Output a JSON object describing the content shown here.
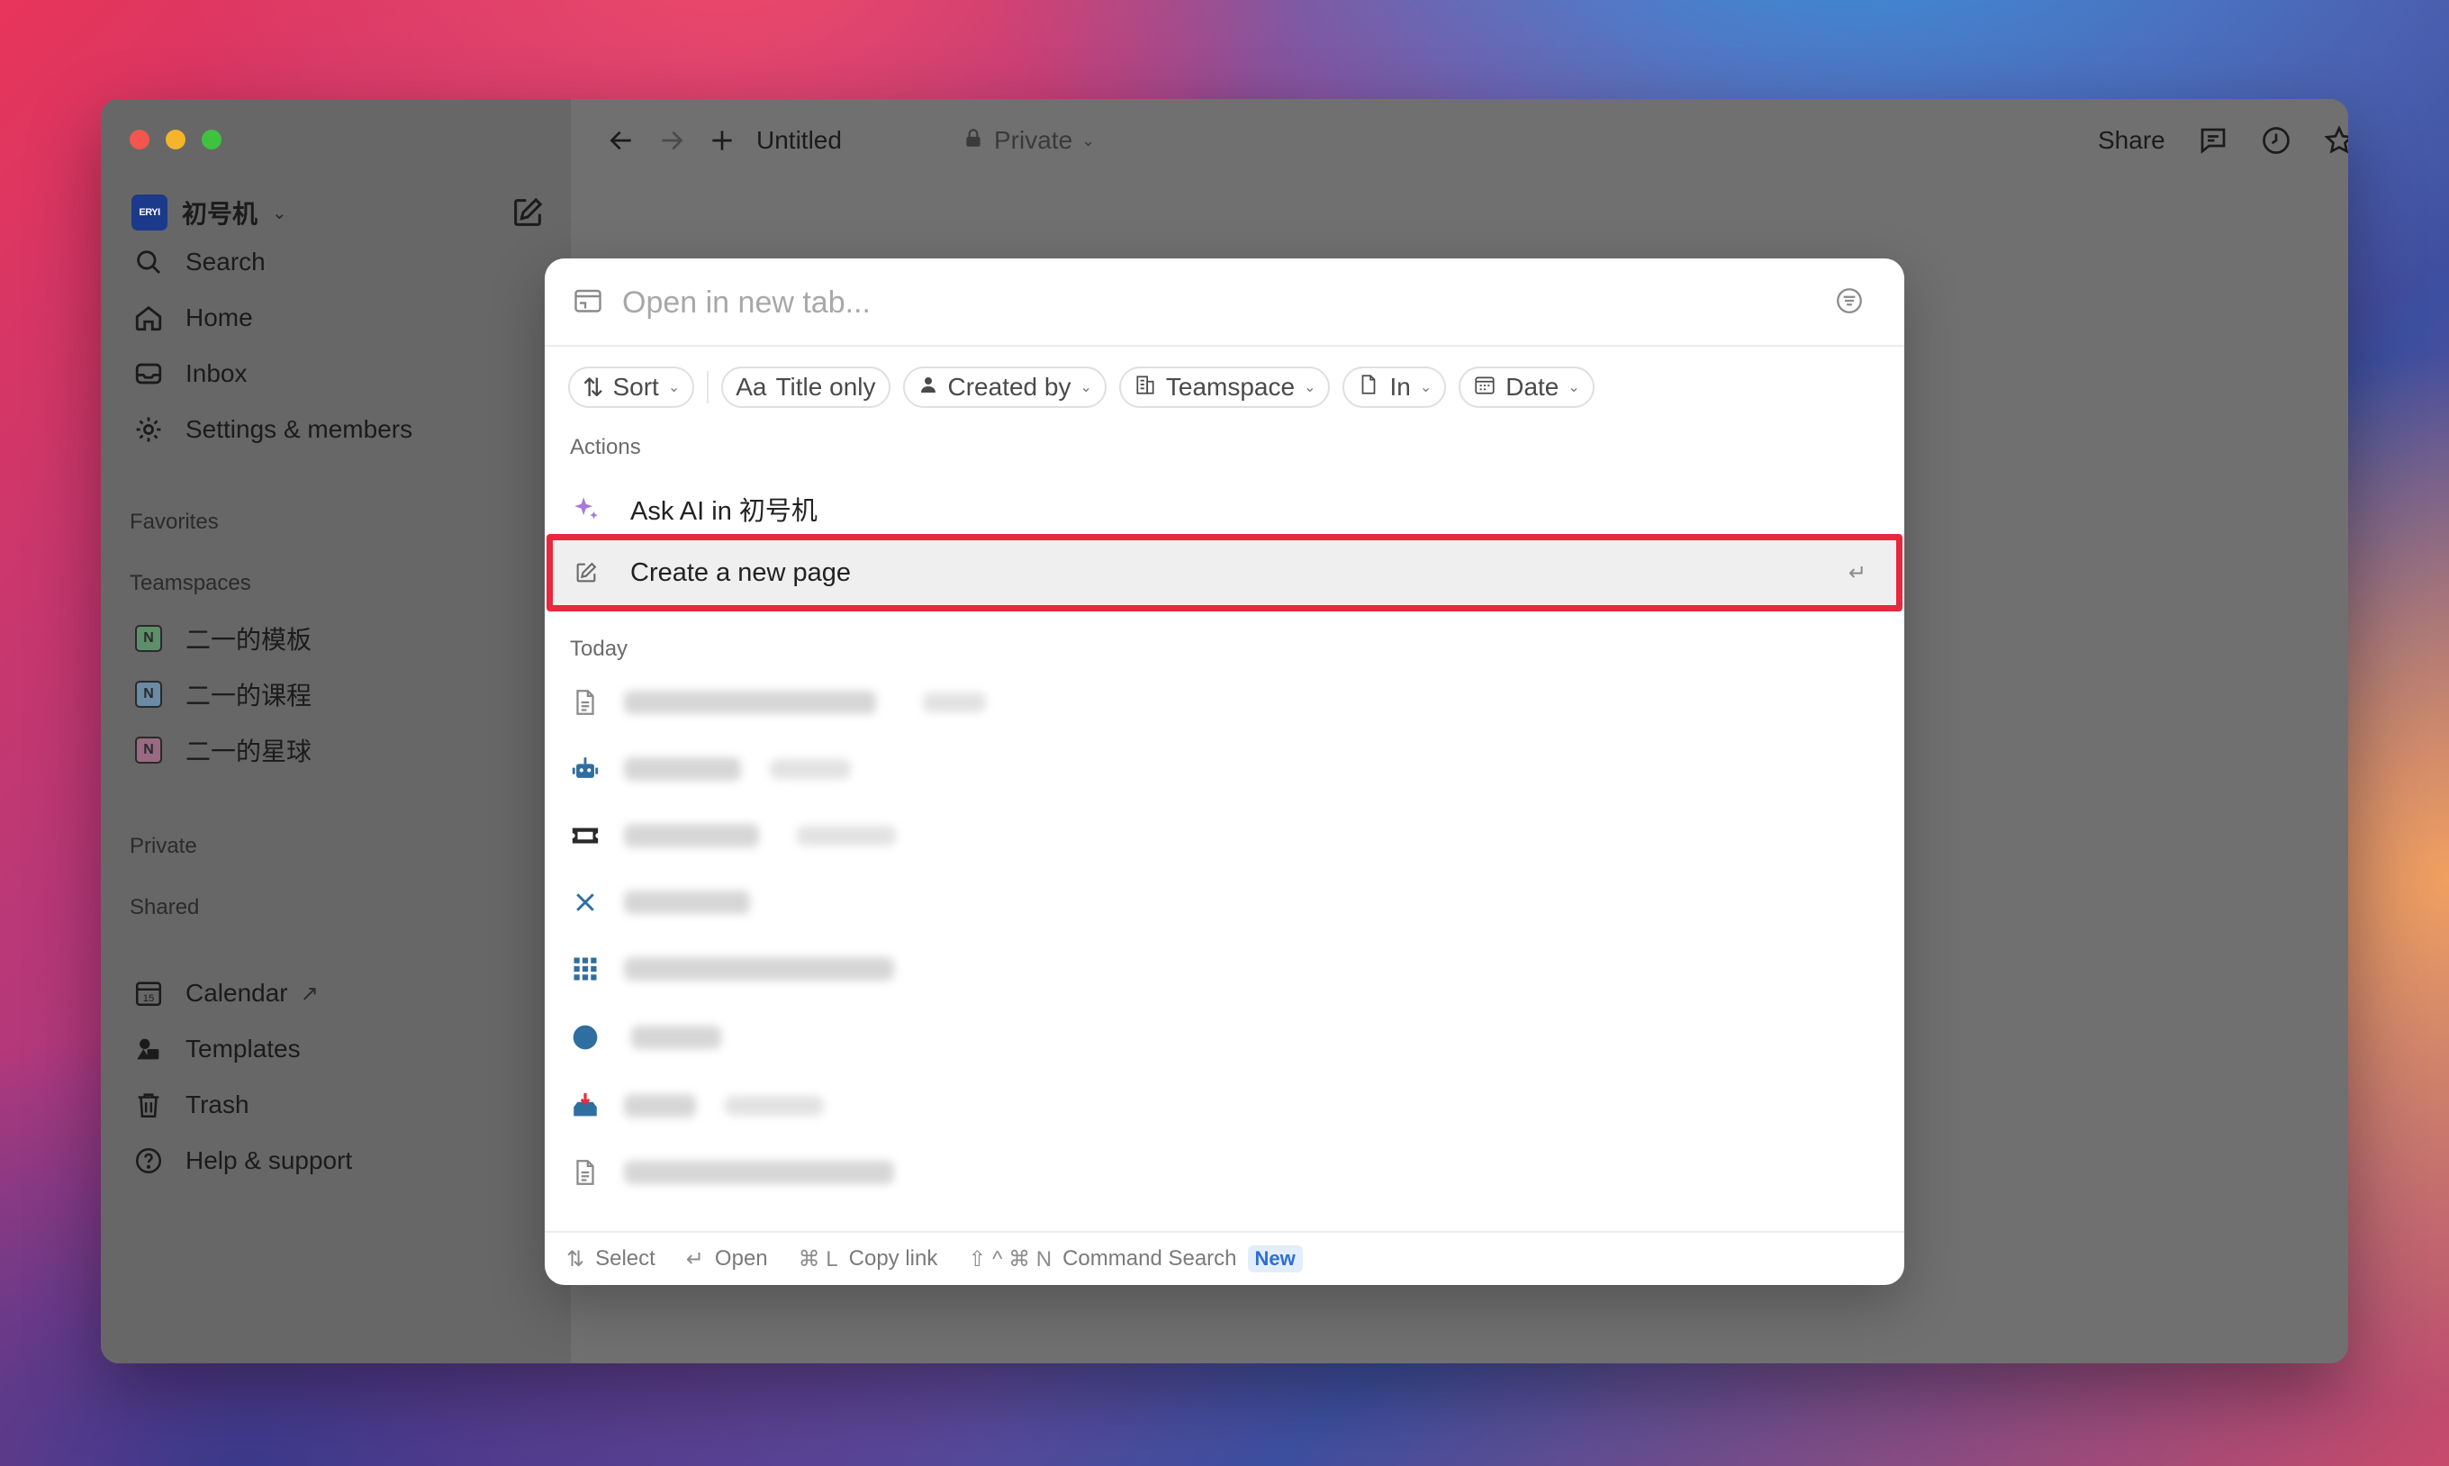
{
  "sidebar": {
    "workspace": {
      "logo": "ERYI",
      "name": "初号机"
    },
    "nav": [
      {
        "label": "Search",
        "icon": "search-icon"
      },
      {
        "label": "Home",
        "icon": "home-icon"
      },
      {
        "label": "Inbox",
        "icon": "inbox-icon"
      },
      {
        "label": "Settings & members",
        "icon": "gear-icon"
      }
    ],
    "favorites_label": "Favorites",
    "teamspaces_label": "Teamspaces",
    "teamspaces": [
      {
        "label": "二一的模板",
        "color": "#3b8a4a"
      },
      {
        "label": "二一的课程",
        "color": "#3a6fb0"
      },
      {
        "label": "二一的星球",
        "color": "#b03a6a"
      }
    ],
    "private_label": "Private",
    "shared_label": "Shared",
    "bottom": [
      {
        "label": "Calendar",
        "icon": "calendar-icon",
        "external": "↗"
      },
      {
        "label": "Templates",
        "icon": "templates-icon"
      },
      {
        "label": "Trash",
        "icon": "trash-icon"
      },
      {
        "label": "Help & support",
        "icon": "help-icon"
      }
    ]
  },
  "topbar": {
    "page_title": "Untitled",
    "privacy": "Private",
    "share": "Share"
  },
  "modal": {
    "search_placeholder": "Open in new tab...",
    "filters": {
      "sort": "Sort",
      "title_only_prefix": "Aa",
      "title_only": "Title only",
      "created_by": "Created by",
      "teamspace": "Teamspace",
      "in": "In",
      "date": "Date"
    },
    "actions_label": "Actions",
    "actions": [
      {
        "label": "Ask AI in 初号机",
        "icon": "sparkle-icon"
      },
      {
        "label": "Create a new page",
        "icon": "compose-icon"
      }
    ],
    "today_label": "Today",
    "accent": "#e8283c",
    "footer": {
      "select_key": "⇅",
      "select": "Select",
      "open_key": "↵",
      "open": "Open",
      "copy_key": "⌘ L",
      "copy": "Copy link",
      "cmd_key": "⇧ ^ ⌘ N",
      "cmd": "Command Search",
      "badge": "New"
    }
  }
}
